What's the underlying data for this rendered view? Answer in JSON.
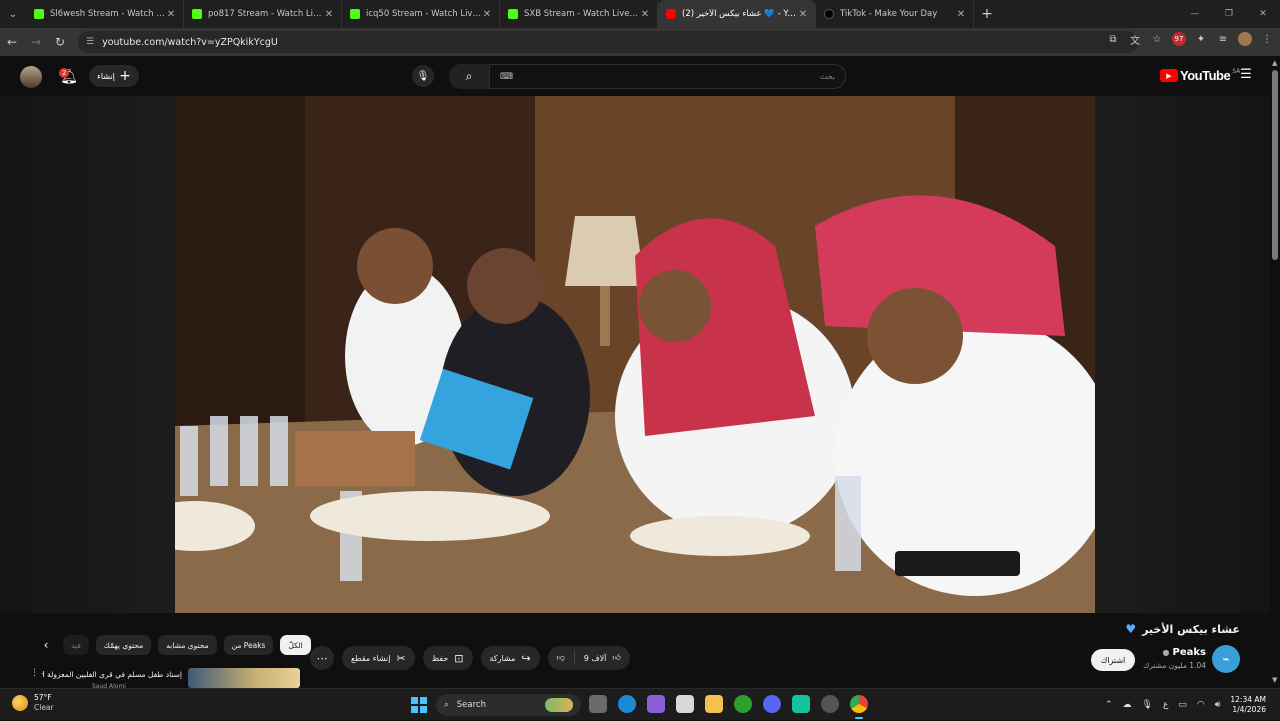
{
  "browser": {
    "tabs": [
      {
        "title": "Sl6wesh Stream - Watch Live on Kick",
        "favicon": "kick-icon",
        "active": false
      },
      {
        "title": "po817 Stream - Watch Live on Kick",
        "favicon": "kick-icon",
        "active": false
      },
      {
        "title": "icq50 Stream - Watch Live on Kick",
        "favicon": "kick-icon",
        "active": false
      },
      {
        "title": "SXB Stream - Watch Live on Kick",
        "favicon": "kick-icon",
        "active": false
      },
      {
        "title": "(2) عشاء بيكس الأخير 💙 - YouTube",
        "favicon": "youtube-icon",
        "active": true
      },
      {
        "title": "TikTok - Make Your Day",
        "favicon": "tiktok-icon",
        "active": false
      }
    ],
    "url": "youtube.com/watch?v=yZPQkikYcgU",
    "extension_badge": "97"
  },
  "masthead": {
    "create_label": "إنشاء",
    "notifications_count": "2",
    "search_placeholder": "بحث",
    "logo_text": "YouTube",
    "region": "SA"
  },
  "video": {
    "title": "عشاء بيكس الأخير",
    "channel_name": "Peaks",
    "subscribers": "1.04 مليون مشترك",
    "subscribe_label": "اشتراك",
    "likes": "9 آلاف",
    "share_label": "مشاركة",
    "save_label": "حفظ",
    "clip_label": "إنشاء مقطع"
  },
  "chips": [
    {
      "label": "الكلّ",
      "active": true
    },
    {
      "label": "من Peaks",
      "active": false
    },
    {
      "label": "محتوى مشابه",
      "active": false
    },
    {
      "label": "محتوى يهمّك",
      "active": false
    },
    {
      "label": "فيد",
      "active": false
    }
  ],
  "recommendation": {
    "title": "إسناد طفل مسلم في قرى الفلبين المعزولة PH",
    "channel": "Saud Alomi"
  },
  "taskbar": {
    "temperature": "57°F",
    "condition": "Clear",
    "search_label": "Search",
    "time": "12:34 AM",
    "date": "1/4/2026",
    "language": "ع"
  },
  "colors": {
    "youtube_red": "#ff0000",
    "kick_green": "#53fc18",
    "background": "#0f0f0f"
  }
}
